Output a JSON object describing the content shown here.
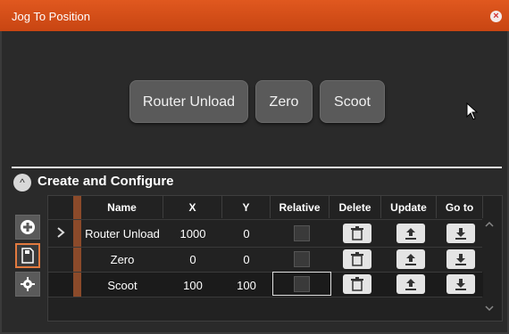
{
  "window": {
    "title": "Jog To Position",
    "close": "×"
  },
  "positions": [
    "Router Unload",
    "Zero",
    "Scoot"
  ],
  "section": {
    "title": "Create and Configure",
    "toggle": "^"
  },
  "table": {
    "headers": [
      "Name",
      "X",
      "Y",
      "Relative",
      "Delete",
      "Update",
      "Go to"
    ],
    "rows": [
      {
        "name": "Router Unload",
        "x": "1000",
        "y": "0"
      },
      {
        "name": "Zero",
        "x": "0",
        "y": "0"
      },
      {
        "name": "Scoot",
        "x": "100",
        "y": "100"
      }
    ]
  },
  "icons": {
    "add": "plus-circle-icon",
    "save": "save-file-icon",
    "settings": "gear-icon",
    "delete": "trash-icon",
    "update": "upload-icon",
    "goto": "download-icon"
  }
}
